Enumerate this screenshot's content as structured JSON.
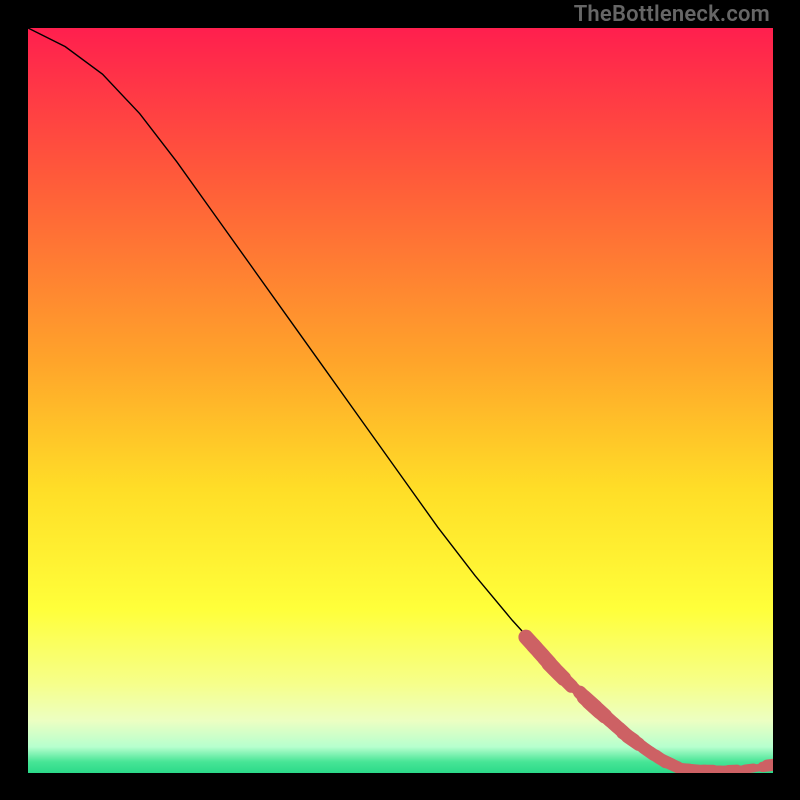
{
  "watermark": "TheBottleneck.com",
  "colors": {
    "curve_stroke": "#000000",
    "point_fill": "#cd6164",
    "point_stroke": "#cd6164"
  },
  "chart_data": {
    "type": "line",
    "title": "",
    "xlabel": "",
    "ylabel": "",
    "xlim": [
      0,
      100
    ],
    "ylim": [
      0,
      100
    ],
    "grid": false,
    "gradient_stops": [
      {
        "offset": 0.0,
        "color": "#ff1f4e"
      },
      {
        "offset": 0.2,
        "color": "#ff5a3a"
      },
      {
        "offset": 0.45,
        "color": "#ffa52a"
      },
      {
        "offset": 0.62,
        "color": "#ffde27"
      },
      {
        "offset": 0.78,
        "color": "#ffff3a"
      },
      {
        "offset": 0.88,
        "color": "#f6ff8a"
      },
      {
        "offset": 0.93,
        "color": "#ecffc2"
      },
      {
        "offset": 0.965,
        "color": "#b6ffce"
      },
      {
        "offset": 0.985,
        "color": "#47e596"
      },
      {
        "offset": 1.0,
        "color": "#2bd989"
      }
    ],
    "curve": [
      {
        "x": 0.0,
        "y": 100.0
      },
      {
        "x": 5.0,
        "y": 97.5
      },
      {
        "x": 10.0,
        "y": 93.8
      },
      {
        "x": 15.0,
        "y": 88.5
      },
      {
        "x": 20.0,
        "y": 82.0
      },
      {
        "x": 25.0,
        "y": 75.0
      },
      {
        "x": 30.0,
        "y": 68.0
      },
      {
        "x": 35.0,
        "y": 61.0
      },
      {
        "x": 40.0,
        "y": 54.0
      },
      {
        "x": 45.0,
        "y": 47.0
      },
      {
        "x": 50.0,
        "y": 40.0
      },
      {
        "x": 55.0,
        "y": 33.0
      },
      {
        "x": 60.0,
        "y": 26.5
      },
      {
        "x": 65.0,
        "y": 20.5
      },
      {
        "x": 70.0,
        "y": 15.0
      },
      {
        "x": 75.0,
        "y": 10.0
      },
      {
        "x": 80.0,
        "y": 5.5
      },
      {
        "x": 85.0,
        "y": 2.0
      },
      {
        "x": 88.0,
        "y": 0.6
      },
      {
        "x": 90.0,
        "y": 0.4
      },
      {
        "x": 93.0,
        "y": 0.4
      },
      {
        "x": 96.0,
        "y": 0.5
      },
      {
        "x": 100.0,
        "y": 1.0
      }
    ],
    "points": [
      {
        "x": 67.5,
        "y": 17.5,
        "r": 1.0
      },
      {
        "x": 68.5,
        "y": 16.4,
        "r": 1.0
      },
      {
        "x": 69.3,
        "y": 15.5,
        "r": 1.0
      },
      {
        "x": 70.0,
        "y": 14.7,
        "r": 1.0
      },
      {
        "x": 70.6,
        "y": 14.0,
        "r": 1.0
      },
      {
        "x": 71.2,
        "y": 13.4,
        "r": 1.0
      },
      {
        "x": 72.3,
        "y": 12.3,
        "r": 0.9
      },
      {
        "x": 73.6,
        "y": 11.2,
        "r": 0.7
      },
      {
        "x": 74.7,
        "y": 10.2,
        "r": 0.9
      },
      {
        "x": 75.4,
        "y": 9.5,
        "r": 1.0
      },
      {
        "x": 76.0,
        "y": 8.9,
        "r": 1.0
      },
      {
        "x": 76.7,
        "y": 8.3,
        "r": 1.0
      },
      {
        "x": 77.5,
        "y": 7.6,
        "r": 0.9
      },
      {
        "x": 78.4,
        "y": 6.8,
        "r": 0.9
      },
      {
        "x": 79.2,
        "y": 6.1,
        "r": 0.9
      },
      {
        "x": 80.0,
        "y": 5.4,
        "r": 0.9
      },
      {
        "x": 80.6,
        "y": 4.9,
        "r": 0.9
      },
      {
        "x": 81.2,
        "y": 4.4,
        "r": 0.9
      },
      {
        "x": 81.8,
        "y": 4.0,
        "r": 0.8
      },
      {
        "x": 82.5,
        "y": 3.5,
        "r": 0.8
      },
      {
        "x": 83.3,
        "y": 2.9,
        "r": 0.8
      },
      {
        "x": 84.1,
        "y": 2.4,
        "r": 0.8
      },
      {
        "x": 84.9,
        "y": 1.9,
        "r": 0.8
      },
      {
        "x": 85.7,
        "y": 1.5,
        "r": 0.8
      },
      {
        "x": 86.5,
        "y": 1.1,
        "r": 0.8
      },
      {
        "x": 87.3,
        "y": 0.8,
        "r": 0.7
      },
      {
        "x": 88.2,
        "y": 0.6,
        "r": 0.7
      },
      {
        "x": 89.2,
        "y": 0.5,
        "r": 0.7
      },
      {
        "x": 90.2,
        "y": 0.4,
        "r": 0.7
      },
      {
        "x": 91.3,
        "y": 0.4,
        "r": 0.7
      },
      {
        "x": 92.4,
        "y": 0.4,
        "r": 0.6
      },
      {
        "x": 93.5,
        "y": 0.4,
        "r": 0.6
      },
      {
        "x": 94.6,
        "y": 0.5,
        "r": 0.6
      },
      {
        "x": 95.7,
        "y": 0.5,
        "r": 0.5
      },
      {
        "x": 96.8,
        "y": 0.6,
        "r": 0.6
      },
      {
        "x": 98.0,
        "y": 0.7,
        "r": 0.5
      },
      {
        "x": 99.3,
        "y": 0.9,
        "r": 0.7
      },
      {
        "x": 100.0,
        "y": 1.1,
        "r": 0.8
      }
    ]
  }
}
